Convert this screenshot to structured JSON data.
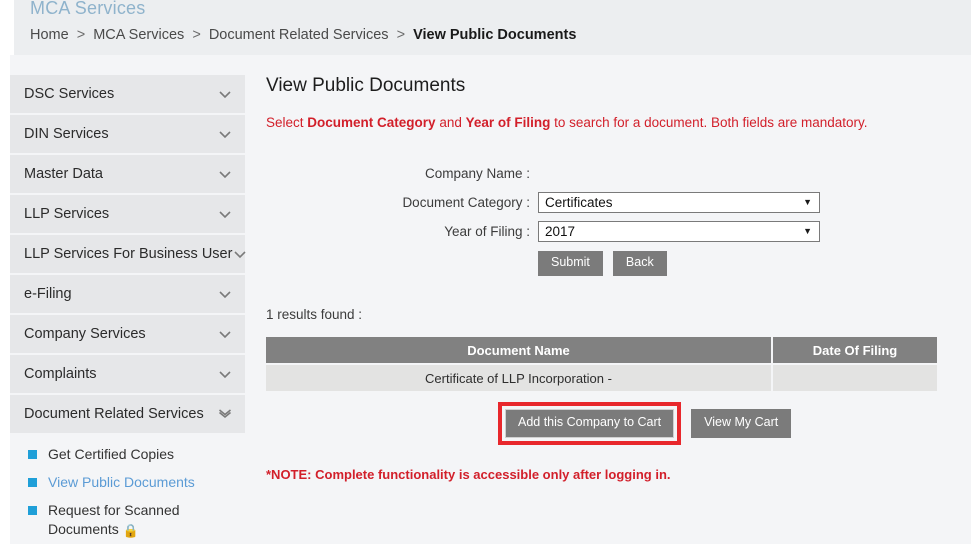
{
  "header": {
    "app_title": "MCA Services",
    "breadcrumb": [
      {
        "label": "Home",
        "current": false
      },
      {
        "label": "MCA Services",
        "current": false
      },
      {
        "label": "Document Related Services",
        "current": false
      },
      {
        "label": "View Public Documents",
        "current": true
      }
    ],
    "separator": ">"
  },
  "sidebar": {
    "accordions": [
      {
        "label": "DSC Services",
        "icon": "chevron-down-icon",
        "expanded": false
      },
      {
        "label": "DIN Services",
        "icon": "chevron-down-icon",
        "expanded": false
      },
      {
        "label": "Master Data",
        "icon": "chevron-down-icon",
        "expanded": false
      },
      {
        "label": "LLP Services",
        "icon": "chevron-down-icon",
        "expanded": false
      },
      {
        "label": "LLP Services For Business User",
        "icon": "chevron-down-icon",
        "expanded": false
      },
      {
        "label": "e-Filing",
        "icon": "chevron-down-icon",
        "expanded": false
      },
      {
        "label": "Company Services",
        "icon": "chevron-down-icon",
        "expanded": false
      },
      {
        "label": "Complaints",
        "icon": "chevron-down-icon",
        "expanded": false
      },
      {
        "label": "Document Related Services",
        "icon": "double-chevron-down-icon",
        "expanded": true
      }
    ],
    "sub_items": [
      {
        "label": "Get Certified Copies",
        "active": false,
        "locked": false
      },
      {
        "label": "View Public Documents",
        "active": true,
        "locked": false
      },
      {
        "label": "Request for Scanned Documents",
        "active": false,
        "locked": true,
        "lock_glyph": "🔒"
      }
    ]
  },
  "main": {
    "page_title": "View Public Documents",
    "instruction": {
      "part1": "Select ",
      "bold1": "Document Category",
      "part2": " and ",
      "bold2": "Year of Filing",
      "part3": " to search for a document. Both fields are mandatory."
    },
    "form": {
      "company_name_label": "Company Name :",
      "company_name_value": "",
      "document_category_label": "Document Category :",
      "document_category_value": "Certificates",
      "year_of_filing_label": "Year of Filing :",
      "year_of_filing_value": "2017",
      "dropdown_arrow": "▼",
      "submit_label": "Submit",
      "back_label": "Back"
    },
    "results": {
      "count_text": "1  results found :",
      "columns": [
        "Document Name",
        "Date Of Filing"
      ],
      "rows": [
        {
          "document_name": "Certificate of LLP Incorporation -",
          "date_of_filing": ""
        }
      ]
    },
    "cart": {
      "add_label": "Add this Company to Cart",
      "view_label": "View My Cart",
      "highlight_color": "#e8272c"
    },
    "note": "*NOTE: Complete functionality is accessible only after logging in."
  },
  "colors": {
    "accent_red": "#d21f2a",
    "link_blue": "#5b9bd5",
    "bullet_blue": "#1f9fd8",
    "header_band": "#eceef0",
    "page_bg": "#f4f5f7",
    "accordion_bg": "#e6e7e9",
    "table_header": "#818181",
    "table_row": "#e3e3e2",
    "button_gray": "#7b7b7b"
  }
}
